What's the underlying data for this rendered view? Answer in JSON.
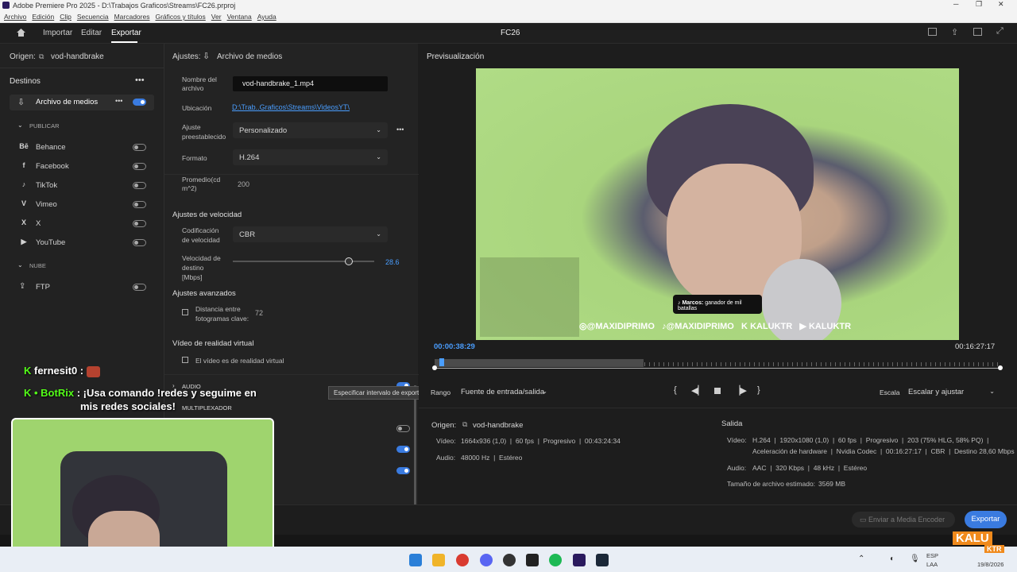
{
  "window": {
    "title": "Adobe Premiere Pro 2025 - D:\\Trabajos Graficos\\Streams\\FC26.prproj"
  },
  "menu": [
    "Archivo",
    "Edición",
    "Clip",
    "Secuencia",
    "Marcadores",
    "Gráficos y títulos",
    "Ver",
    "Ventana",
    "Ayuda"
  ],
  "nav": {
    "import": "Importar",
    "edit": "Editar",
    "export": "Exportar",
    "project": "FC26"
  },
  "left": {
    "origin_label": "Origen:",
    "origin_value": "vod-handbrake",
    "destinations": "Destinos",
    "media_file": "Archivo de medios",
    "publish": "PUBLICAR",
    "items": [
      "Behance",
      "Facebook",
      "TikTok",
      "Vimeo",
      "X",
      "YouTube"
    ],
    "cloud": "NUBE",
    "ftp": "FTP"
  },
  "settings": {
    "header_label": "Ajustes:",
    "header_value": "Archivo de medios",
    "name_label": "Nombre del archivo",
    "name_value": "vod-handbrake_1.mp4",
    "location_label": "Ubicación",
    "location_value": "D:\\Trab..Graficos\\Streams\\VideosYT\\",
    "preset_label": "Ajuste preestablecido",
    "preset_value": "Personalizado",
    "format_label": "Formato",
    "format_value": "H.264",
    "avg_label": "Promedio(cd m^2)",
    "avg_value": "200",
    "speed_section": "Ajustes de velocidad",
    "coding_label": "Codificación de velocidad",
    "coding_value": "CBR",
    "target_label": "Velocidad de destino [Mbps]",
    "target_value": "28.6",
    "target_fraction": 0.82,
    "advanced_section": "Ajustes avanzados",
    "keyframe_label": "Distancia entre fotogramas clave:",
    "keyframe_value": "72",
    "vr_section": "Vídeo de realidad virtual",
    "vr_label": "El vídeo es de realidad virtual",
    "audio": "AUDIO",
    "mux": "MULTIPLEXADOR",
    "tooltip": "Especificar intervalo de exportación"
  },
  "preview": {
    "title": "Previsualización",
    "time_current": "00:00:38:29",
    "time_total": "00:16:27:17",
    "range_label": "Rango",
    "range_value": "Fuente de entrada/salida",
    "scale_label": "Escala",
    "scale_value": "Escalar y ajustar",
    "playhead_fraction": 0.008,
    "inout_end_fraction": 0.37
  },
  "overlay": {
    "handles": [
      "@MAXIDIPRIMO",
      "@MAXIDIPRIMO",
      "KALUKTR",
      "KALUKTR"
    ],
    "tiktok_name": "Marcos:",
    "tiktok_msg": "ganador de mil batallas"
  },
  "source": {
    "label": "Origen:",
    "name": "vod-handbrake",
    "video_label": "Vídeo:",
    "video_value": "1664x936 (1,0)  |  60 fps  |  Progresivo  |  00:43:24:34",
    "audio_label": "Audio:",
    "audio_value": "48000 Hz  |  Estéreo"
  },
  "output": {
    "title": "Salida",
    "video_label": "Vídeo:",
    "video_line1": "H.264  |  1920x1080 (1,0)  |  60 fps  |  Progresivo  |  203 (75% HLG, 58% PQ)  |",
    "video_line2": "Aceleración de hardware  |  Nvidia Codec  |  00:16:27:17  |  CBR  |  Destino 28,60 Mbps",
    "audio_label": "Audio:",
    "audio_value": "AAC  |  320 Kbps  |  48 kHz  |  Estéreo",
    "size_label": "Tamaño de archivo estimado:",
    "size_value": "3569 MB"
  },
  "footer": {
    "encoder": "Enviar a Media Encoder",
    "export": "Exportar"
  },
  "stream": {
    "chat1_user": "fernesit0 :",
    "chat2_user": "BotRix",
    "chat2_msg": ": ¡Usa comando !redes y seguime en",
    "chat2_msg2": "mis redes sociales!",
    "logo": "KALU",
    "logo2": "KTR"
  },
  "taskbar": {
    "lang1": "ESP",
    "lang2": "LAA",
    "date": "19/8/2026"
  },
  "colors": {
    "accent": "#3a7be0",
    "link": "#4a9eff",
    "webcam": "#9fd46e"
  }
}
